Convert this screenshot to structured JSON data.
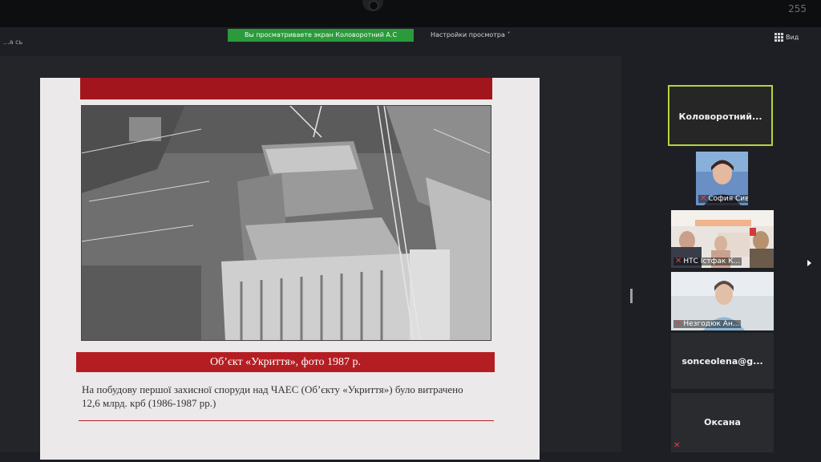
{
  "device": {
    "corner_number": "255"
  },
  "zoom": {
    "top_left_text": "...а сь",
    "sharing_banner": "Вы просматриваете экран Коловоротний А.С",
    "view_settings_label": "Настройки просмотра",
    "view_button_label": "Вид",
    "accent_color": "#2a9a3a"
  },
  "slide": {
    "caption": "Об’єкт «Укриття», фото 1987 р.",
    "text": "На побудову першої захисної споруди над ЧАЕС (Об’єкту «Укриття») було витрачено 12,6 млрд. крб (1986-1987 рр.)",
    "accent_color": "#b41e22"
  },
  "participants": [
    {
      "name": "Коловоротний...",
      "type": "name-only",
      "active": true
    },
    {
      "name": "София Сиве...",
      "type": "video",
      "muted": true
    },
    {
      "name": "НТС Істфак К...",
      "type": "video",
      "muted": true
    },
    {
      "name": "Незгодюк Ан...",
      "type": "video",
      "muted": true
    },
    {
      "name": "sonceolena@g...",
      "type": "name-only",
      "muted": false
    },
    {
      "name": "Оксана",
      "type": "name-only",
      "muted": true
    }
  ]
}
